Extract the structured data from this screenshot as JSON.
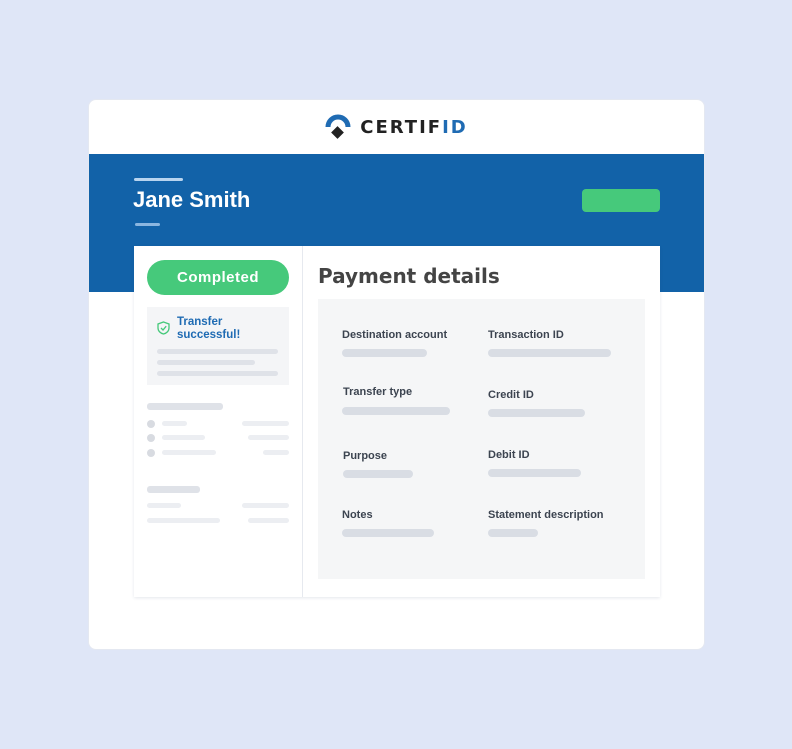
{
  "logo": {
    "text_main": "CERTIF",
    "text_accent": "ID",
    "mark_icon": "certifid-logo-icon"
  },
  "header": {
    "name": "Jane Smith"
  },
  "status": {
    "pill_label": "Completed",
    "notice_text": "Transfer successful!",
    "notice_icon": "shield-check-icon"
  },
  "payment": {
    "title": "Payment details",
    "fields": [
      "Destination account",
      "Transaction ID",
      "Transfer type",
      "Credit ID",
      "Purpose",
      "Debit ID",
      "Notes",
      "Statement description"
    ]
  },
  "colors": {
    "band": "#1262a8",
    "success": "#46c97b",
    "accent": "#1f6bb3",
    "background": "#dfe6f7"
  }
}
